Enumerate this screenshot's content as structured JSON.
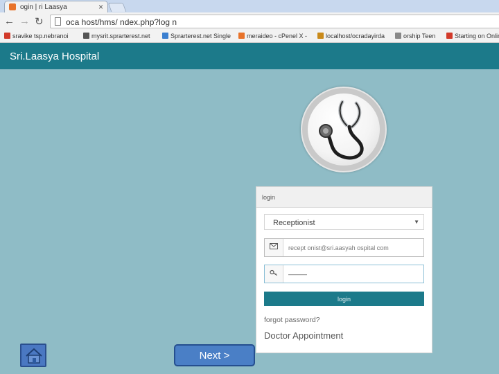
{
  "browser": {
    "tab_title": "ogin | ri Laasya",
    "tab_close": "×",
    "url": "oca host/hms/ ndex.php?log n",
    "back_icon": "arrow-left-icon",
    "forward_icon": "arrow-right-icon",
    "reload_icon": "reload-icon",
    "bookmarks": [
      {
        "label": "sravike tsp.nebranoi",
        "color": "#d23a2a"
      },
      {
        "label": "mysrit.sprarterest.net",
        "color": "#555555"
      },
      {
        "label": "Sprarterest.net Single",
        "color": "#3b7fd0"
      },
      {
        "label": "meraideo - cPenel X -",
        "color": "#e8732a"
      },
      {
        "label": "localhost/ocradayirda",
        "color": "#c98a1a"
      },
      {
        "label": "orship Teen",
        "color": "#888888"
      },
      {
        "label": "Starting on Online",
        "color": "#d23a2a"
      }
    ]
  },
  "app": {
    "brand": "Sri.Laasya Hospital",
    "logo_icon": "stethoscope-icon"
  },
  "login": {
    "heading": "login",
    "role_value": "Receptionist",
    "role_caret": "▼",
    "email_icon": "envelope-icon",
    "email_value": "recept onist@sri.aasyah ospital com",
    "password_icon": "key-icon",
    "password_value": "———",
    "button_label": "login",
    "forgot_link": "forgot password?",
    "doctor_link": "Doctor Appointment"
  },
  "controls": {
    "home_icon": "home-icon",
    "next_label": "Next  >"
  },
  "colors": {
    "page_bg": "#8fbcc6",
    "header_bg": "#1c7a8a",
    "button_bg": "#1c7a8a",
    "nav_button_bg": "#4a7fc6"
  }
}
